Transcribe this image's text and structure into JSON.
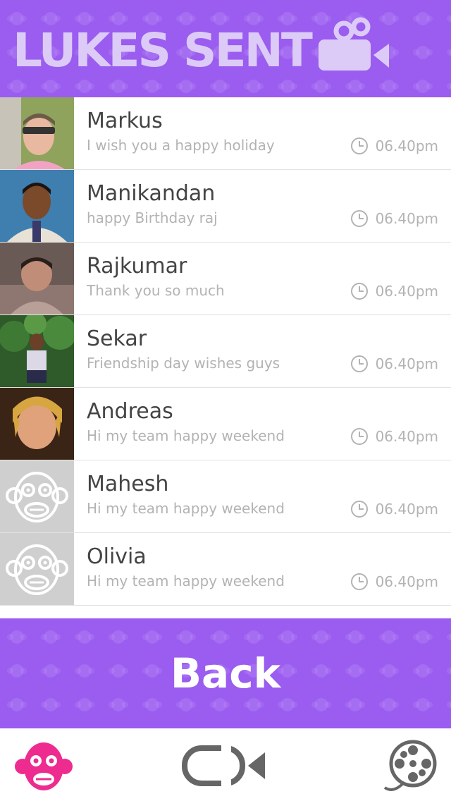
{
  "header": {
    "title": "LUKES SENT",
    "icon": "video-camera-icon",
    "background_color": "#9b5cf0"
  },
  "contacts": [
    {
      "name": "Markus",
      "message": "I wish you a happy holiday",
      "time": "06.40pm",
      "avatar": "photo-markus"
    },
    {
      "name": "Manikandan",
      "message": "happy Birthday raj",
      "time": "06.40pm",
      "avatar": "photo-manikandan"
    },
    {
      "name": "Rajkumar",
      "message": "Thank you so much",
      "time": "06.40pm",
      "avatar": "photo-rajkumar"
    },
    {
      "name": "Sekar",
      "message": "Friendship day wishes guys",
      "time": "06.40pm",
      "avatar": "photo-sekar"
    },
    {
      "name": "Andreas",
      "message": "Hi my team happy weekend",
      "time": "06.40pm",
      "avatar": "photo-andreas"
    },
    {
      "name": "Mahesh",
      "message": "Hi my team happy weekend",
      "time": "06.40pm",
      "avatar": "monkey-placeholder-icon"
    },
    {
      "name": "Olivia",
      "message": "Hi my team happy weekend",
      "time": "06.40pm",
      "avatar": "monkey-placeholder-icon"
    }
  ],
  "back_button": {
    "label": "Back"
  },
  "tabbar": {
    "items": [
      {
        "icon": "monkey-icon",
        "color": "#ee2b8f",
        "active": true
      },
      {
        "icon": "video-camera-icon",
        "color": "#666666",
        "active": false
      },
      {
        "icon": "film-reel-icon",
        "color": "#666666",
        "active": false
      }
    ]
  },
  "colors": {
    "accent_purple": "#9b5cf0",
    "accent_pink": "#ee2b8f",
    "muted_text": "#b3b3b3",
    "name_text": "#444444"
  }
}
